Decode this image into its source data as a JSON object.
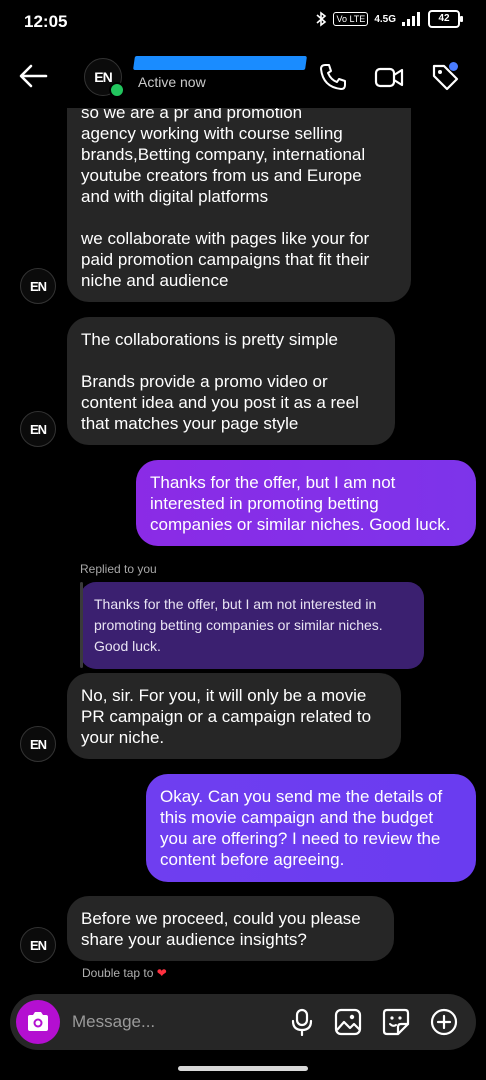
{
  "status": {
    "time": "12:05",
    "volte": "Vo LTE",
    "network": "4.5G",
    "battery": "42"
  },
  "header": {
    "avatar_initials": "EN",
    "subtitle": "Active now"
  },
  "messages": {
    "m1": "so we are a pr and promotion\nagency working with course selling\nbrands,Betting company, international\nyoutube creators from us and Europe\nand with digital platforms\n\nwe collaborate with pages like your for\npaid promotion campaigns that fit their\nniche and  audience",
    "m2": "The collaborations is pretty simple\n\nBrands provide a promo video or\ncontent idea and you post it as a reel\nthat matches your page style",
    "m3": "Thanks for the offer, but I am not\ninterested in promoting betting\ncompanies or similar niches. Good luck.",
    "replied_label": "Replied to you",
    "quoted": "Thanks for the offer, but I am not interested in promoting betting companies or similar niches. Good luck.",
    "m4": "No, sir. For you, it will only be a movie\nPR campaign or a campaign related to\nyour niche.",
    "m5": "Okay. Can you send me the details of\nthis movie campaign and the budget\nyou are offering? I need to review the\ncontent before agreeing.",
    "m6": "Before we proceed, could you please\nshare your audience insights?",
    "double_tap": "Double tap to"
  },
  "composer": {
    "placeholder": "Message..."
  },
  "icons": [
    "back-arrow-icon",
    "phone-icon",
    "video-camera-icon",
    "tag-icon",
    "camera-icon",
    "microphone-icon",
    "gallery-icon",
    "sticker-icon",
    "plus-icon",
    "heart-icon"
  ],
  "colors": {
    "incoming": "#262626",
    "outgoing_purple": "#8a2be2",
    "outgoing_blue": "#6a3cf0",
    "camera_button": "#b40fd1",
    "online": "#22c55e"
  }
}
